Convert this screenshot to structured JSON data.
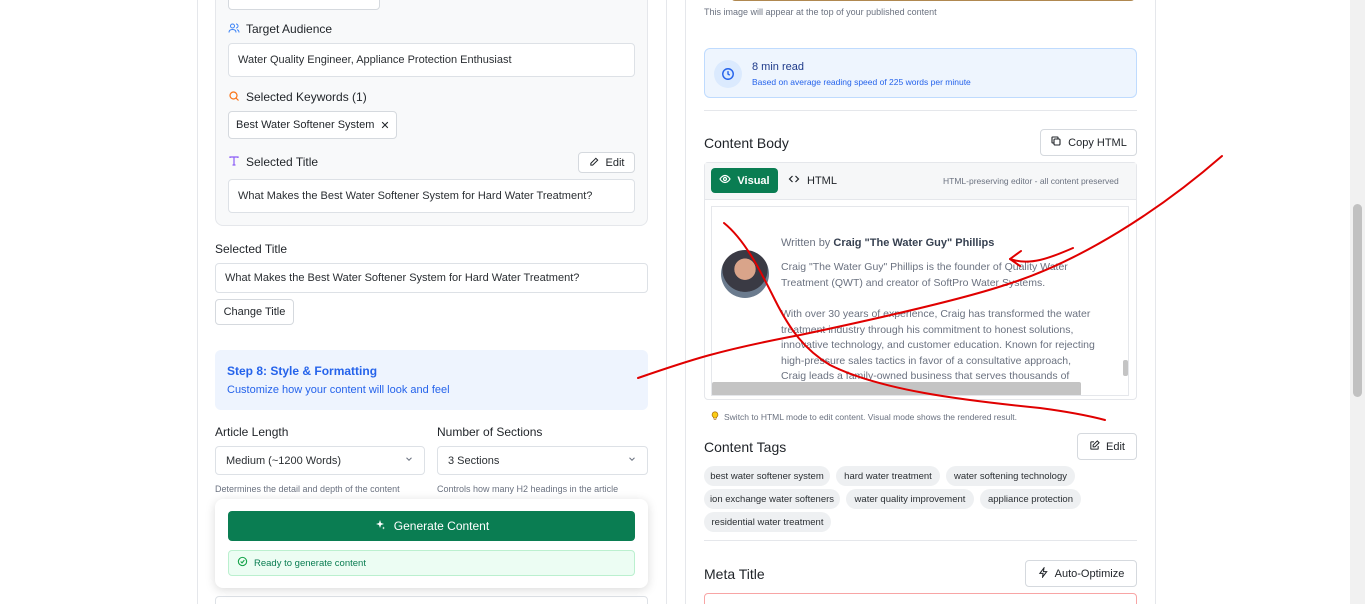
{
  "left": {
    "target_audience": {
      "label": "Target Audience",
      "value": "Water Quality Engineer, Appliance Protection Enthusiast"
    },
    "keywords": {
      "label": "Selected Keywords (1)",
      "chip": "Best Water Softener System",
      "chip_remove": "✕"
    },
    "selected_title_card": {
      "label": "Selected Title",
      "edit_label": "Edit",
      "value": "What Makes the Best Water Softener System for Hard Water Treatment?"
    },
    "selected_title": {
      "label": "Selected Title",
      "value": "What Makes the Best Water Softener System for Hard Water Treatment?",
      "change_label": "Change Title"
    },
    "step8": {
      "title": "Step 8: Style & Formatting",
      "subtitle": "Customize how your content will look and feel"
    },
    "article_length": {
      "label": "Article Length",
      "value": "Medium (~1200 Words)",
      "help": "Determines the detail and depth of the content"
    },
    "sections": {
      "label": "Number of Sections",
      "value": "3 Sections",
      "help": "Controls how many H2 headings in the article"
    },
    "generate": {
      "label": "Generate Content",
      "status": "Ready to generate content"
    }
  },
  "right": {
    "image_caption": "This image will appear at the top of your published content",
    "read_time": {
      "title": "8 min read",
      "subtitle": "Based on average reading speed of 225 words per minute"
    },
    "content_body": {
      "title": "Content Body",
      "copy_label": "Copy HTML",
      "tab_visual": "Visual",
      "tab_html": "HTML",
      "editor_note": "HTML-preserving editor - all content preserved",
      "written_by_prefix": "Written by",
      "author": "Craig \"The Water Guy\" Phillips",
      "para1": "Craig \"The Water Guy\" Phillips is the founder of Quality Water Treatment (QWT) and creator of SoftPro Water Systems.",
      "para2": "With over 30 years of experience, Craig has transformed the water treatment industry through his commitment to honest solutions, innovative technology, and customer education.  Known for rejecting high-pressure sales tactics in favor of a consultative approach, Craig leads a family-owned business that serves thousands of households",
      "hint": "Switch to HTML mode to edit content. Visual mode shows the rendered result."
    },
    "tags": {
      "title": "Content Tags",
      "edit_label": "Edit",
      "items": [
        "best water softener system",
        "hard water treatment",
        "water softening technology",
        "ion exchange water softeners",
        "water quality improvement",
        "appliance protection",
        "residential water treatment"
      ]
    },
    "meta": {
      "title": "Meta Title",
      "auto_label": "Auto-Optimize"
    }
  },
  "colors": {
    "accent_green": "#0a7d52",
    "accent_blue": "#2563eb",
    "annotation_red": "#e00000"
  }
}
